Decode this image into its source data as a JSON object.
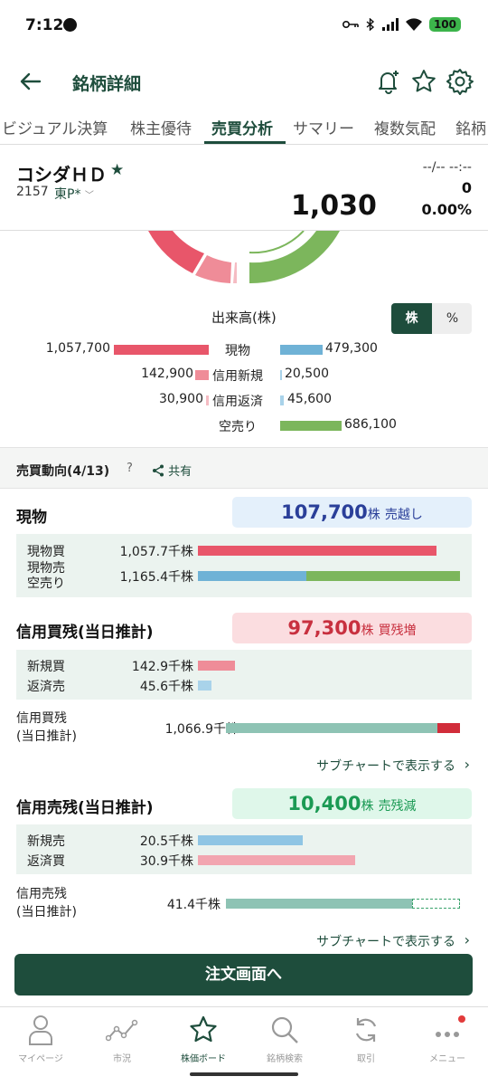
{
  "status_bar": {
    "time": "7:12",
    "battery": "100"
  },
  "header": {
    "title": "銘柄詳細"
  },
  "tabs": [
    "ビジュアル決算",
    "株主優待",
    "売買分析",
    "サマリー",
    "複数気配",
    "銘柄"
  ],
  "active_tab": "売買分析",
  "stock": {
    "name": "コシダＨＤ",
    "code": "2157",
    "market": "東P*",
    "price": "1,030",
    "time": "--/-- --:--",
    "change": "0",
    "change_pct": "0.00%"
  },
  "volume": {
    "title": "出来高(株)",
    "toggle": {
      "shares": "株",
      "percent": "%"
    },
    "rows": [
      {
        "left_value": "1,057,700",
        "category": "現物",
        "right_value": "479,300"
      },
      {
        "left_value": "142,900",
        "category": "信用新規",
        "right_value": "20,500"
      },
      {
        "left_value": "30,900",
        "category": "信用返済",
        "right_value": "45,600"
      },
      {
        "left_value": "",
        "category": "空売り",
        "right_value": "686,100"
      }
    ]
  },
  "trend": {
    "title": "売買動向(4/13)",
    "help": "?",
    "share": "共有"
  },
  "genbutsu": {
    "title": "現物",
    "summary_value": "107,700",
    "summary_unit": "株",
    "summary_label": "売越し",
    "rows": [
      {
        "label": "現物買",
        "value": "1,057.7千株"
      },
      {
        "label": "現物売",
        "label2": "空売り",
        "value": "1,165.4千株"
      }
    ]
  },
  "credit_buy": {
    "title": "信用買残(当日推計)",
    "summary_value": "97,300",
    "summary_unit": "株",
    "summary_label": "買残増",
    "rows": [
      {
        "label": "新規買",
        "value": "142.9千株"
      },
      {
        "label": "返済売",
        "value": "45.6千株"
      }
    ],
    "balance_label1": "信用買残",
    "balance_label2": "(当日推計)",
    "balance_value": "1,066.9千株",
    "subchart_link": "サブチャートで表示する"
  },
  "credit_sell": {
    "title": "信用売残(当日推計)",
    "summary_value": "10,400",
    "summary_unit": "株",
    "summary_label": "売残減",
    "rows": [
      {
        "label": "新規売",
        "value": "20.5千株"
      },
      {
        "label": "返済買",
        "value": "30.9千株"
      }
    ],
    "balance_label1": "信用売残",
    "balance_label2": "(当日推計)",
    "balance_value": "41.4千株",
    "subchart_link": "サブチャートで表示する"
  },
  "order_button": "注文画面へ",
  "bottom_nav": [
    {
      "label": "マイページ",
      "icon": "person-icon"
    },
    {
      "label": "市況",
      "icon": "market-icon"
    },
    {
      "label": "株価ボード",
      "icon": "star-icon"
    },
    {
      "label": "銘柄検索",
      "icon": "search-icon"
    },
    {
      "label": "取引",
      "icon": "refresh-icon"
    },
    {
      "label": "メニュー",
      "icon": "more-icon"
    }
  ],
  "colors": {
    "brand": "#1e4d3c",
    "buy": "#e8566a",
    "buy_light": "#ef8c98",
    "sell": "#6fb2d6",
    "sell_light": "#a9d3ea",
    "short": "#7cb65c",
    "balance": "#8ec3b4",
    "pill_blue_bg": "#e4f0fb",
    "pill_red_bg": "#fbdde0",
    "pill_green_bg": "#dff7ea"
  }
}
